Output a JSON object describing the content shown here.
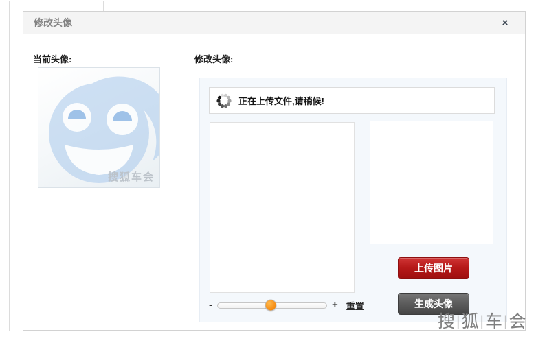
{
  "dialog": {
    "title": "修改头像",
    "close_label": "×"
  },
  "current_avatar": {
    "label": "当前头像:",
    "image_watermark": "搜狐车会"
  },
  "editor": {
    "label": "修改头像:",
    "status_message": "正在上传文件,请稍候!",
    "zoom_out_label": "-",
    "zoom_in_label": "+",
    "reset_label": "重置",
    "slider_position_percent": 49,
    "upload_button_label": "上传图片",
    "generate_button_label": "生成头像"
  },
  "watermark": {
    "chars": [
      "搜",
      "狐",
      "车",
      "会"
    ],
    "separator": "|"
  },
  "colors": {
    "upload_button": "#b51818",
    "generate_button": "#5b5b5b",
    "slider_handle": "#f7941d",
    "panel_background": "#f4f8fc",
    "header_background": "#f4f4f4"
  }
}
